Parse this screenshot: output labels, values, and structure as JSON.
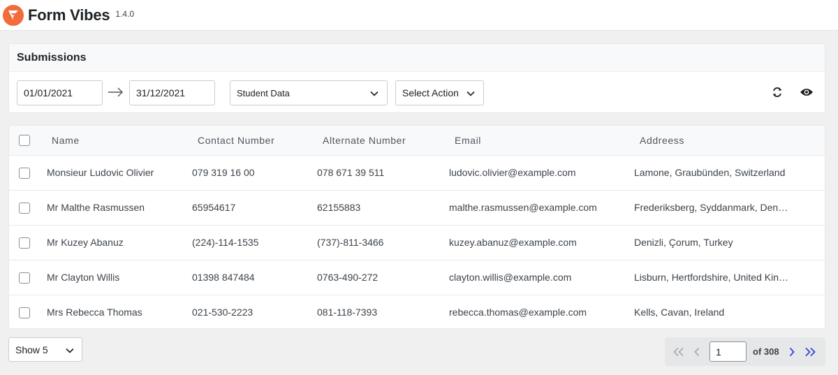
{
  "app": {
    "name": "Form Vibes",
    "version": "1.4.0"
  },
  "panel": {
    "title": "Submissions",
    "date_from": "01/01/2021",
    "date_to": "31/12/2021",
    "form_select": "Student Data",
    "action_select": "Select Action",
    "icons": [
      "refresh-icon",
      "eye-icon"
    ]
  },
  "table": {
    "columns": [
      "Name",
      "Contact Number",
      "Alternate Number",
      "Email",
      "Addreess"
    ],
    "rows": [
      [
        "Monsieur Ludovic Olivier",
        "079 319 16 00",
        "078 671 39 511",
        "ludovic.olivier@example.com",
        "Lamone, Graubünden, Switzerland"
      ],
      [
        "Mr Malthe Rasmussen",
        "65954617",
        "62155883",
        "malthe.rasmussen@example.com",
        "Frederiksberg, Syddanmark, Denmark"
      ],
      [
        "Mr Kuzey Abanuz",
        "(224)-114-1535",
        "(737)-811-3466",
        "kuzey.abanuz@example.com",
        "Denizli, Çorum, Turkey"
      ],
      [
        "Mr Clayton Willis",
        "01398 847484",
        "0763-490-272",
        "clayton.willis@example.com",
        "Lisburn, Hertfordshire, United Kingdom"
      ],
      [
        "Mrs Rebecca Thomas",
        "021-530-2223",
        "081-118-7393",
        "rebecca.thomas@example.com",
        "Kells, Cavan, Ireland"
      ]
    ]
  },
  "pagination": {
    "show_label": "Show 5",
    "current_page": "1",
    "of_label": "of 308"
  },
  "colors": {
    "brand": "#f26b3a",
    "active_nav": "#2c3fd4",
    "disabled_nav": "#a7aaad"
  }
}
